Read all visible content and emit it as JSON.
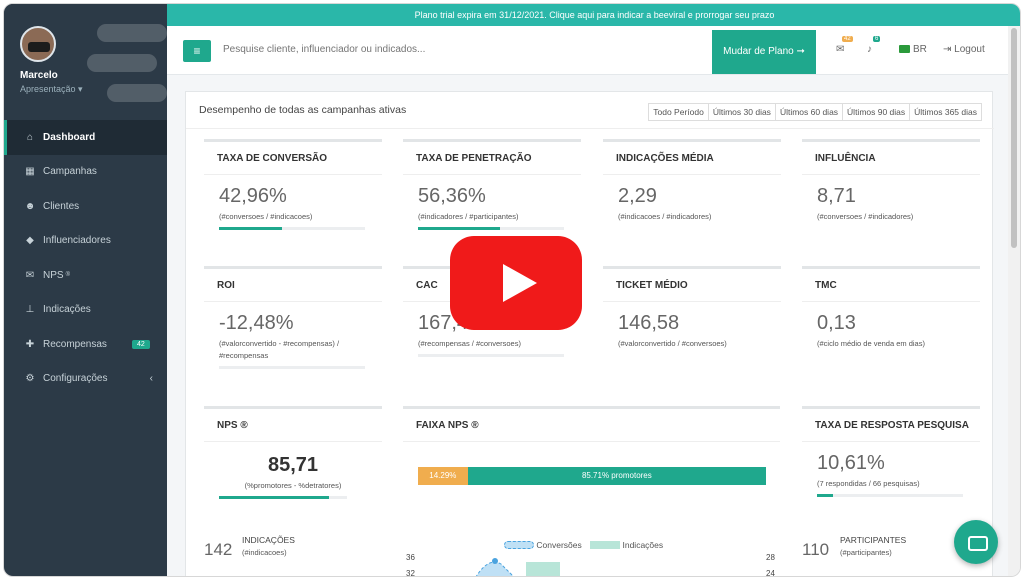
{
  "trial_banner": "Plano trial expira em 31/12/2021. Clique aqui para indicar a beeviral e prorrogar seu prazo",
  "user": {
    "name": "Marcelo",
    "role": "Apresentação ▾"
  },
  "sidebar": {
    "items": [
      {
        "label": "Dashboard",
        "icon": "home-icon"
      },
      {
        "label": "Campanhas",
        "icon": "grid-icon"
      },
      {
        "label": "Clientes",
        "icon": "users-icon"
      },
      {
        "label": "Influenciadores",
        "icon": "diamond-icon"
      },
      {
        "label": "NPS",
        "sup": "®",
        "icon": "mail-icon"
      },
      {
        "label": "Indicações",
        "icon": "sitemap-icon"
      },
      {
        "label": "Recompensas",
        "icon": "gift-icon",
        "badge": "42"
      },
      {
        "label": "Configurações",
        "icon": "gears-icon",
        "arrow": "‹"
      }
    ]
  },
  "topbar": {
    "search_placeholder": "Pesquise cliente, influenciador ou indicados...",
    "plan_button": "Mudar de Plano ➞",
    "mail_badge": "42",
    "bell_badge": "6",
    "language": "BR",
    "logout": "Logout"
  },
  "panel": {
    "title": "Desempenho de todas as campanhas ativas",
    "periods": [
      "Todo Período",
      "Últimos 30 dias",
      "Últimos 60 dias",
      "Últimos 90 dias",
      "Últimos 365 dias"
    ]
  },
  "cards": [
    {
      "label": "TAXA DE CONVERSÃO",
      "value": "42,96%",
      "sub": "(#conversoes / #indicacoes)",
      "progress": 0.43
    },
    {
      "label": "TAXA DE PENETRAÇÃO",
      "value": "56,36%",
      "sub": "(#indicadores / #participantes)",
      "progress": 0.56
    },
    {
      "label": "INDICAÇÕES MÉDIA",
      "value": "2,29",
      "sub": "(#indicacoes / #indicadores)"
    },
    {
      "label": "INFLUÊNCIA",
      "value": "8,71",
      "sub": "(#conversoes / #indicadores)"
    },
    {
      "label": "ROI",
      "value": "-12,48%",
      "sub": "(#valorconvertido - #recompensas) / #recompensas"
    },
    {
      "label": "CAC",
      "value": "167,49",
      "sub": "(#recompensas / #conversoes)"
    },
    {
      "label": "TICKET MÉDIO",
      "value": "146,58",
      "sub": "(#valorconvertido / #conversoes)"
    },
    {
      "label": "TMC",
      "value": "0,13",
      "sub": "(#ciclo médio de venda em dias)"
    }
  ],
  "nps": {
    "label": "NPS ®",
    "value": "85,71",
    "sub": "(%promotores - %detratores)",
    "progress": 0.86
  },
  "faixa_nps": {
    "label": "FAIXA NPS ®",
    "detratores": "14.29%",
    "promotores": "85.71% promotores",
    "det_fraction": 0.1429
  },
  "resposta": {
    "label": "TAXA DE RESPOSTA PESQUISA",
    "value": "10,61%",
    "sub": "(7 respondidas / 66 pesquisas)",
    "progress": 0.11
  },
  "bottom": {
    "indicacoes": {
      "value": "142",
      "label": "INDICAÇÕES",
      "sub": "(#indicacoes)"
    },
    "participantes": {
      "value": "110",
      "label": "PARTICIPANTES",
      "sub": "(#participantes)"
    },
    "chart_legend": [
      "Conversões",
      "Indicações"
    ],
    "y_left": [
      "36",
      "32"
    ],
    "y_right": [
      "28",
      "24"
    ]
  },
  "colors": {
    "accent": "#1fa88d",
    "banner": "#2ab7a9",
    "sidebar": "#2c3a47",
    "warning": "#f0ad4e",
    "video_play": "#f01a1a"
  }
}
